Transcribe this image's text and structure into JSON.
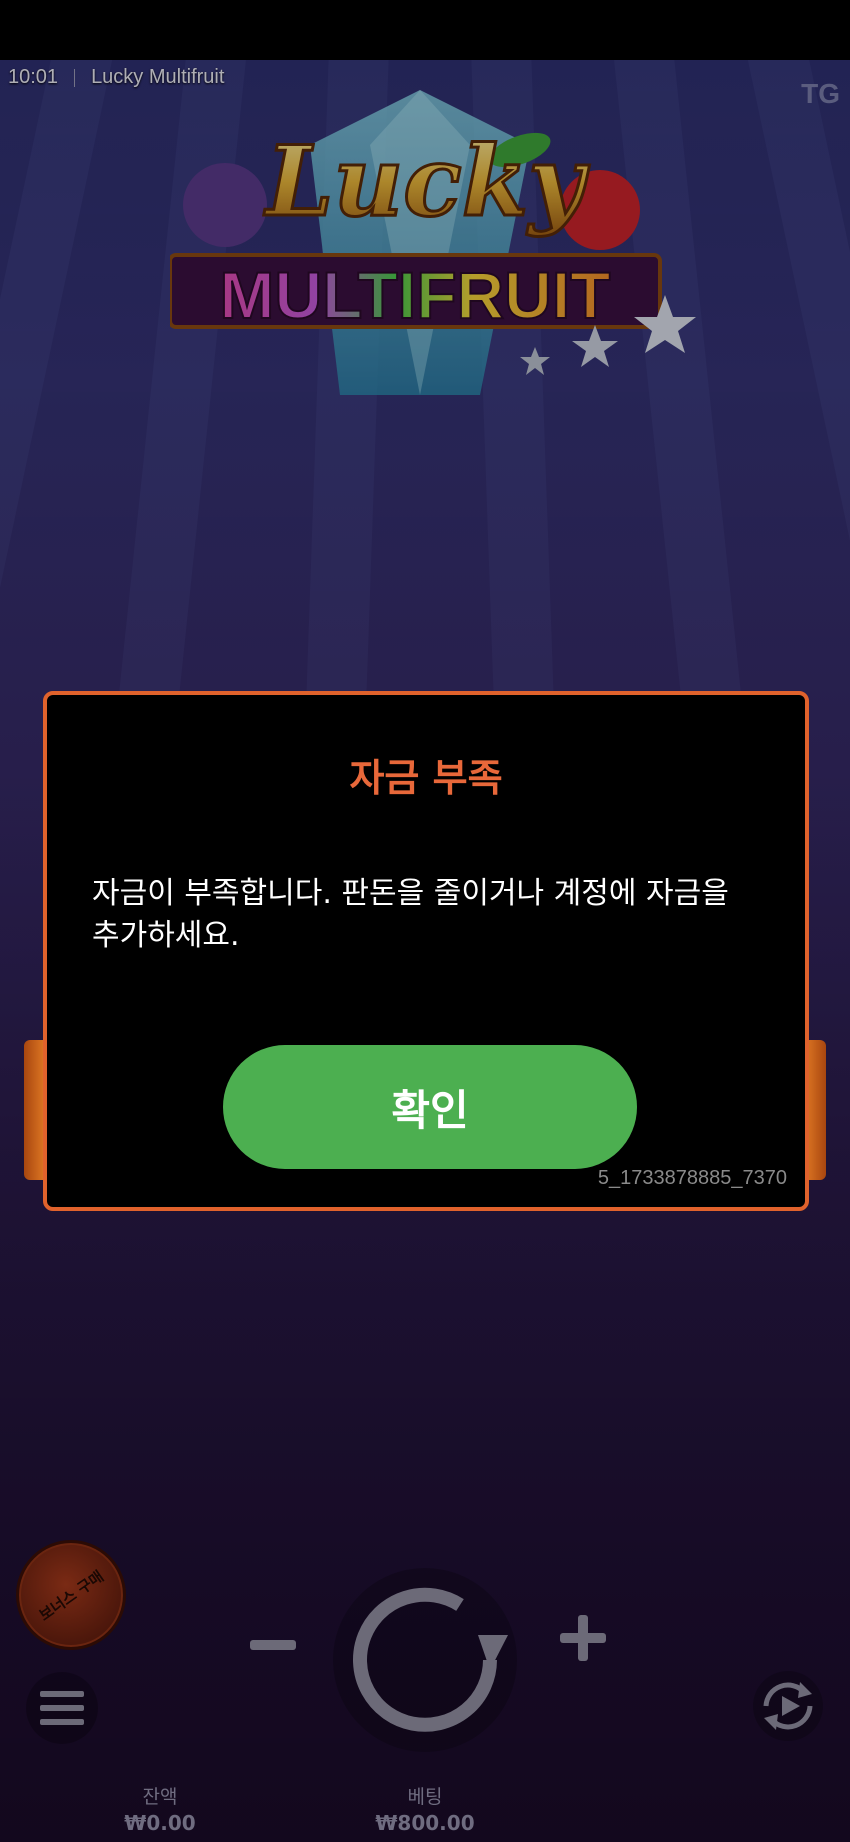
{
  "status": {
    "time": "10:01",
    "game_title": "Lucky Multifruit",
    "brand": "TG"
  },
  "logo": {
    "word1": "Lucky",
    "word2": "MULTIFRUIT"
  },
  "dialog": {
    "title": "자금 부족",
    "message": "자금이 부족합니다. 판돈을 줄이거나 계정에 자금을 추가하세요.",
    "confirm_label": "확인",
    "error_code": "5_1733878885_7370"
  },
  "controls": {
    "bonus_buy_label": "보너스 구매",
    "balance_label": "잔액",
    "balance_value": "₩0.00",
    "bet_label": "베팅",
    "bet_value": "₩800.00"
  },
  "colors": {
    "dialog_border": "#e0622c",
    "dialog_title": "#e8683a",
    "confirm_button": "#4caf50"
  }
}
